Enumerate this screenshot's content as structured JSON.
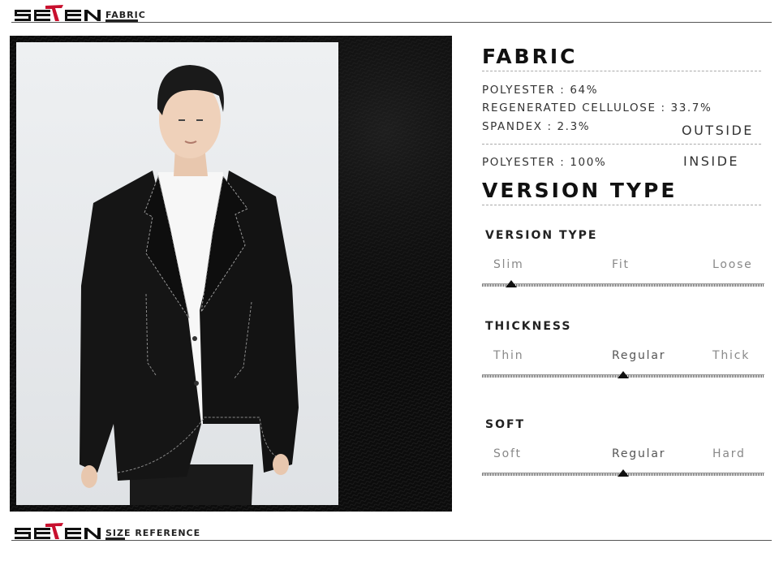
{
  "brand": {
    "logo_text": "SEVEN",
    "accent_color": "#c8102e"
  },
  "top_bar": {
    "section_label": "FABRIC"
  },
  "bottom_bar": {
    "section_label": "SIZE REFERENCE"
  },
  "fabric": {
    "title": "FABRIC",
    "outside_lines": [
      "POLYESTER   : 64%",
      "REGENERATED CELLULOSE : 33.7%",
      "SPANDEX : 2.3%"
    ],
    "outside_label": "OUTSIDE",
    "inside_line": "POLYESTER : 100%",
    "inside_label": "INSIDE"
  },
  "version_type": {
    "title": "VERSION TYPE",
    "scales": [
      {
        "title": "VERSION TYPE",
        "options": [
          "Slim",
          "Fit",
          "Loose"
        ],
        "selected_index": 0,
        "marker_fraction": 0.1
      },
      {
        "title": "THICKNESS",
        "options": [
          "Thin",
          "Regular",
          "Thick"
        ],
        "selected_index": 1,
        "marker_fraction": 0.5
      },
      {
        "title": "SOFT",
        "options": [
          "Soft",
          "Regular",
          "Hard"
        ],
        "selected_index": 1,
        "marker_fraction": 0.5
      }
    ]
  },
  "images": {
    "model_photo": "model-in-black-slim-blazer",
    "fabric_swatch": "black-knit-fabric-closeup"
  }
}
